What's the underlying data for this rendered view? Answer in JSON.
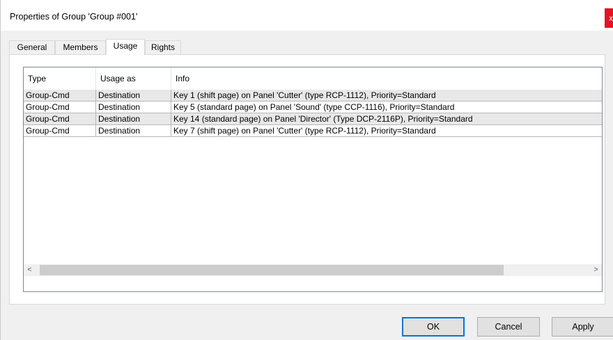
{
  "window": {
    "title": "Properties of Group 'Group #001'",
    "close_label": "x"
  },
  "tabs": [
    {
      "label": "General",
      "active": false
    },
    {
      "label": "Members",
      "active": false
    },
    {
      "label": "Usage",
      "active": true
    },
    {
      "label": "Rights",
      "active": false
    }
  ],
  "usage_list": {
    "columns": [
      "Type",
      "Usage as",
      "Info"
    ],
    "rows": [
      [
        "Group-Cmd",
        "Destination",
        "Key 1 (shift page) on Panel 'Cutter' (type RCP-1112), Priority=Standard"
      ],
      [
        "Group-Cmd",
        "Destination",
        "Key 5 (standard page) on Panel 'Sound' (type CCP-1116), Priority=Standard"
      ],
      [
        "Group-Cmd",
        "Destination",
        "Key 14 (standard page) on Panel 'Director' (Type DCP-2116P), Priority=Standard"
      ],
      [
        "Group-Cmd",
        "Destination",
        "Key 7 (shift page) on Panel 'Cutter' (type RCP-1112), Priority=Standard"
      ]
    ],
    "scroll_left_icon": "chevron-left-icon",
    "scroll_right_icon": "chevron-right-icon",
    "scroll_left_glyph": "<",
    "scroll_right_glyph": ">"
  },
  "buttons": {
    "ok_label": "OK",
    "cancel_label": "Cancel",
    "apply_label": "Apply"
  },
  "colors": {
    "close_button": "#e81123",
    "default_button_border": "#0078d7",
    "alt_row": "#e8e8e8"
  }
}
